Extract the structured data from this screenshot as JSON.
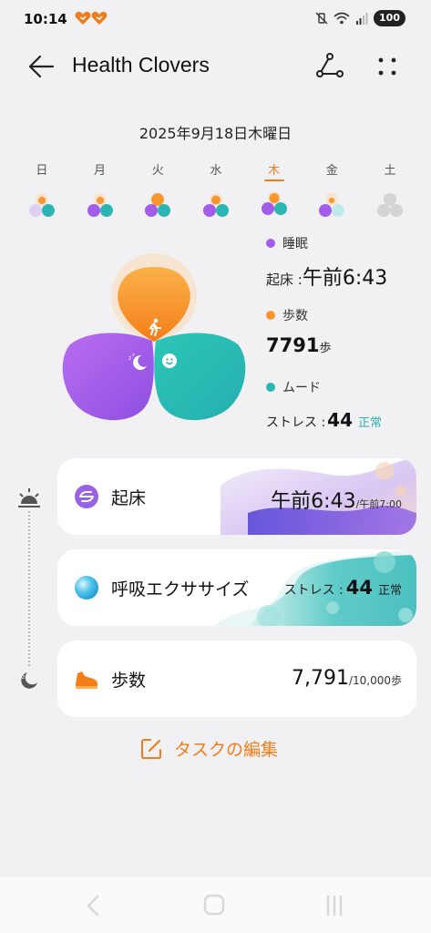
{
  "status_bar": {
    "time": "10:14",
    "battery": "100"
  },
  "header": {
    "title": "Health Clovers",
    "back_icon": "arrow-left-icon",
    "share_icon": "share-icon",
    "more_icon": "more-dots-icon"
  },
  "date": "2025年9月18日木曜日",
  "week": {
    "days": [
      "日",
      "月",
      "火",
      "水",
      "木",
      "金",
      "土"
    ],
    "selected_index": 4
  },
  "metrics": {
    "sleep": {
      "label": "睡眠",
      "prefix": "起床 : ",
      "value": "午前6:43",
      "color": "#a35ce8"
    },
    "steps": {
      "label": "歩数",
      "value": "7791",
      "unit": "歩",
      "color": "#f8972f"
    },
    "mood": {
      "label": "ムード",
      "prefix": "ストレス : ",
      "value": "44",
      "status": "正常",
      "color": "#2bb5b4"
    }
  },
  "tasks": [
    {
      "label": "起床",
      "value": "午前6:43",
      "target": "/午前7:00"
    },
    {
      "label": "呼吸エクササイズ",
      "prefix": "ストレス : ",
      "value": "44",
      "status": "正常"
    },
    {
      "label": "歩数",
      "value": "7,791",
      "target": "/10,000歩"
    }
  ],
  "edit_tasks": {
    "label": "タスクの編集"
  },
  "colors": {
    "orange": "#f8972f",
    "purple": "#a35ce8",
    "teal": "#2bb5b4",
    "accent": "#f07d1b"
  }
}
